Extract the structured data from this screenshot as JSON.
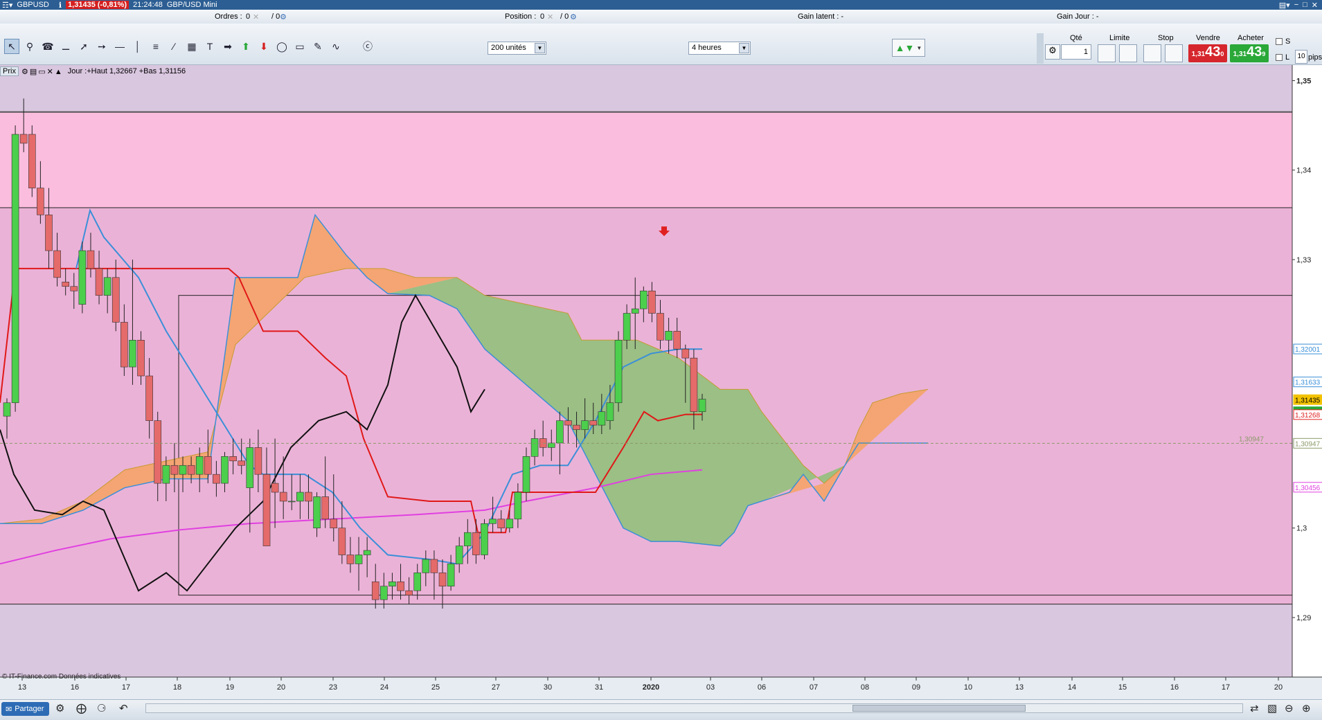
{
  "titlebar": {
    "symbol": "GBPUSD",
    "price_badge": "1,31435 (-0,81%)",
    "time": "21:24:48",
    "instrument": "GBP/USD Mini"
  },
  "orderbar": {
    "orders_label": "Ordres :",
    "orders_value": "0",
    "orders_slash": "/ 0",
    "position_label": "Position :",
    "position_value": "0",
    "position_slash": "/ 0",
    "gain_latent": "Gain latent : -",
    "gain_jour": "Gain Jour : -"
  },
  "toolbar": {
    "units": "200 unités",
    "timeframe": "4 heures",
    "qte_label": "Qté",
    "qte_value": "1",
    "limite_label": "Limite",
    "stop_label": "Stop",
    "vendre_label": "Vendre",
    "acheter_label": "Acheter",
    "sell_small": "1,31",
    "sell_big": "43",
    "sell_sup": "0",
    "buy_small": "1,31",
    "buy_big": "43",
    "buy_sup": "9",
    "s_label": "S",
    "l_label": "L",
    "pips_value": "10",
    "pips_label": "pips"
  },
  "chart_header": {
    "prix": "Prix",
    "info": "Jour :+Haut 1,32667 +Bas 1,31156"
  },
  "chart_data": {
    "type": "candlestick",
    "y_ticks": [
      "1,35",
      "1,34",
      "1,33",
      "1,3",
      "1,29"
    ],
    "y_tick_values": [
      1.35,
      1.34,
      1.33,
      1.3,
      1.29
    ],
    "ylim": [
      1.2835,
      1.3505
    ],
    "x_ticks": [
      "13",
      "16",
      "17",
      "18",
      "19",
      "20",
      "23",
      "24",
      "25",
      "27",
      "30",
      "31",
      "2020",
      "03",
      "06",
      "07",
      "08",
      "09",
      "10",
      "13",
      "14",
      "15",
      "16",
      "17",
      "20"
    ],
    "price_labels": [
      {
        "text": "1,32001",
        "value": 1.32001,
        "color": "#3a8fd8"
      },
      {
        "text": "1,31633",
        "value": 1.31633,
        "color": "#3a8fd8"
      },
      {
        "text": "1,31435",
        "value": 1.31435,
        "color": "#f2c200"
      },
      {
        "text": "3h35m5",
        "value": 1.313,
        "color": "#2aa838"
      },
      {
        "text": "1,31268",
        "value": 1.31268,
        "color": "#e02020"
      },
      {
        "text": "1,30947",
        "value": 1.30947,
        "color": "#8a9a6a"
      },
      {
        "text": "1,30456",
        "value": 1.30456,
        "color": "#e040e0"
      }
    ],
    "dashed_level_label": "1,30947",
    "candles": [
      [
        1.3125,
        1.3145,
        1.31,
        1.314
      ],
      [
        1.314,
        1.345,
        1.313,
        1.344
      ],
      [
        1.344,
        1.348,
        1.342,
        1.343
      ],
      [
        1.344,
        1.345,
        1.337,
        1.338
      ],
      [
        1.338,
        1.341,
        1.334,
        1.335
      ],
      [
        1.335,
        1.338,
        1.329,
        1.331
      ],
      [
        1.331,
        1.333,
        1.327,
        1.328
      ],
      [
        1.3275,
        1.329,
        1.326,
        1.327
      ],
      [
        1.327,
        1.3285,
        1.3245,
        1.3265
      ],
      [
        1.325,
        1.332,
        1.324,
        1.331
      ],
      [
        1.331,
        1.333,
        1.328,
        1.329
      ],
      [
        1.329,
        1.331,
        1.325,
        1.326
      ],
      [
        1.326,
        1.329,
        1.324,
        1.328
      ],
      [
        1.328,
        1.33,
        1.322,
        1.323
      ],
      [
        1.323,
        1.325,
        1.317,
        1.318
      ],
      [
        1.318,
        1.33,
        1.316,
        1.321
      ],
      [
        1.321,
        1.322,
        1.316,
        1.317
      ],
      [
        1.317,
        1.319,
        1.31,
        1.312
      ],
      [
        1.312,
        1.313,
        1.303,
        1.305
      ],
      [
        1.305,
        1.308,
        1.303,
        1.307
      ],
      [
        1.307,
        1.3095,
        1.304,
        1.306
      ],
      [
        1.306,
        1.308,
        1.304,
        1.307
      ],
      [
        1.307,
        1.308,
        1.305,
        1.306
      ],
      [
        1.306,
        1.309,
        1.304,
        1.308
      ],
      [
        1.308,
        1.311,
        1.305,
        1.306
      ],
      [
        1.306,
        1.3075,
        1.3035,
        1.305
      ],
      [
        1.305,
        1.3085,
        1.304,
        1.308
      ],
      [
        1.308,
        1.31,
        1.306,
        1.3075
      ],
      [
        1.3075,
        1.31,
        1.306,
        1.307
      ],
      [
        1.3045,
        1.31,
        1.2995,
        1.309
      ],
      [
        1.309,
        1.311,
        1.304,
        1.306
      ],
      [
        1.306,
        1.309,
        1.3,
        1.298
      ],
      [
        1.305,
        1.31,
        1.3,
        1.304
      ],
      [
        1.304,
        1.308,
        1.301,
        1.303
      ],
      [
        1.303,
        1.306,
        1.302,
        1.303
      ],
      [
        1.303,
        1.306,
        1.301,
        1.304
      ],
      [
        1.304,
        1.306,
        1.301,
        1.303
      ],
      [
        1.3,
        1.304,
        1.299,
        1.3035
      ],
      [
        1.3035,
        1.308,
        1.3,
        1.301
      ],
      [
        1.301,
        1.306,
        1.2985,
        1.3
      ],
      [
        1.3,
        1.303,
        1.296,
        1.297
      ],
      [
        1.297,
        1.299,
        1.295,
        1.296
      ],
      [
        1.296,
        1.299,
        1.293,
        1.297
      ],
      [
        1.297,
        1.299,
        1.2945,
        1.2975
      ],
      [
        1.294,
        1.296,
        1.291,
        1.292
      ],
      [
        1.292,
        1.295,
        1.291,
        1.2935
      ],
      [
        1.2935,
        1.295,
        1.292,
        1.294
      ],
      [
        1.294,
        1.296,
        1.292,
        1.293
      ],
      [
        1.293,
        1.2945,
        1.2915,
        1.2925
      ],
      [
        1.293,
        1.296,
        1.292,
        1.295
      ],
      [
        1.295,
        1.2975,
        1.2935,
        1.2965
      ],
      [
        1.2965,
        1.2975,
        1.292,
        1.295
      ],
      [
        1.295,
        1.2965,
        1.291,
        1.2935
      ],
      [
        1.2935,
        1.297,
        1.293,
        1.296
      ],
      [
        1.296,
        1.299,
        1.295,
        1.298
      ],
      [
        1.298,
        1.301,
        1.296,
        1.2995
      ],
      [
        1.2995,
        1.301,
        1.296,
        1.297
      ],
      [
        1.297,
        1.301,
        1.2965,
        1.3005
      ],
      [
        1.3005,
        1.3035,
        1.2995,
        1.301
      ],
      [
        1.301,
        1.302,
        1.2995,
        1.3
      ],
      [
        1.3,
        1.302,
        1.2995,
        1.301
      ],
      [
        1.301,
        1.305,
        1.3,
        1.304
      ],
      [
        1.304,
        1.309,
        1.303,
        1.308
      ],
      [
        1.308,
        1.311,
        1.307,
        1.31
      ],
      [
        1.31,
        1.312,
        1.308,
        1.309
      ],
      [
        1.309,
        1.311,
        1.3075,
        1.3095
      ],
      [
        1.3095,
        1.313,
        1.306,
        1.312
      ],
      [
        1.312,
        1.3135,
        1.3095,
        1.3115
      ],
      [
        1.3115,
        1.313,
        1.309,
        1.311
      ],
      [
        1.311,
        1.3145,
        1.31,
        1.312
      ],
      [
        1.312,
        1.314,
        1.3105,
        1.3115
      ],
      [
        1.3115,
        1.315,
        1.3105,
        1.313
      ],
      [
        1.312,
        1.316,
        1.311,
        1.314
      ],
      [
        1.314,
        1.322,
        1.313,
        1.321
      ],
      [
        1.321,
        1.325,
        1.32,
        1.324
      ],
      [
        1.324,
        1.328,
        1.32,
        1.3245
      ],
      [
        1.3245,
        1.327,
        1.323,
        1.3265
      ],
      [
        1.3265,
        1.3275,
        1.323,
        1.324
      ],
      [
        1.324,
        1.3255,
        1.32,
        1.321
      ],
      [
        1.321,
        1.3235,
        1.3195,
        1.322
      ],
      [
        1.322,
        1.3235,
        1.319,
        1.32
      ],
      [
        1.32,
        1.3205,
        1.314,
        1.319
      ],
      [
        1.319,
        1.32,
        1.311,
        1.313
      ],
      [
        1.313,
        1.315,
        1.312,
        1.3144
      ]
    ]
  },
  "credit": "© IT-Finance.com  Données indicatives",
  "bottombar": {
    "share": "Partager"
  }
}
